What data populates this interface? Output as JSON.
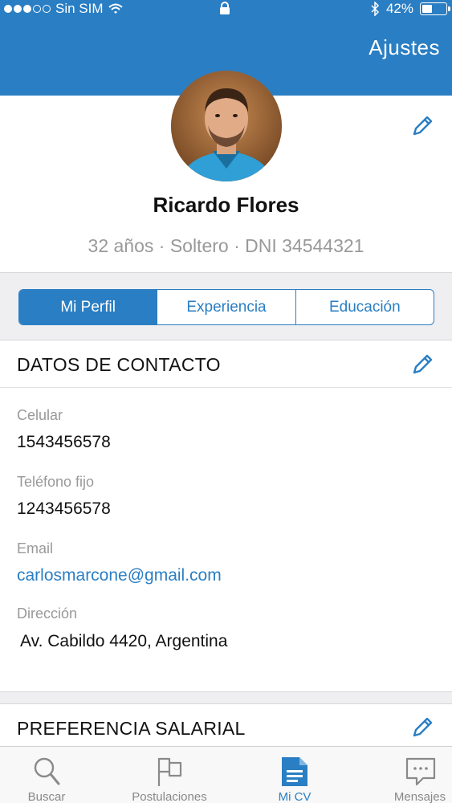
{
  "status_bar": {
    "carrier": "Sin SIM",
    "battery": "42%",
    "battery_level": 0.42
  },
  "header": {
    "settings_label": "Ajustes"
  },
  "profile": {
    "name": "Ricardo Flores",
    "details": "32 años · Soltero · DNI 34544321"
  },
  "tabs": [
    {
      "label": "Mi Perfil",
      "active": true
    },
    {
      "label": "Experiencia",
      "active": false
    },
    {
      "label": "Educación",
      "active": false
    }
  ],
  "contact": {
    "title": "DATOS DE CONTACTO",
    "fields": [
      {
        "label": "Celular",
        "value": "1543456578"
      },
      {
        "label": "Teléfono fijo",
        "value": "1243456578"
      },
      {
        "label": "Email",
        "value": "carlosmarcone@gmail.com"
      },
      {
        "label": "Dirección",
        "value": "Av. Cabildo 4420, Argentina"
      }
    ]
  },
  "salary": {
    "title": "PREFERENCIA SALARIAL"
  },
  "bottom_nav": [
    {
      "label": "Buscar",
      "icon": "search-icon"
    },
    {
      "label": "Postulaciones",
      "icon": "flag-icon"
    },
    {
      "label": "Mi CV",
      "icon": "document-icon",
      "active": true
    },
    {
      "label": "Mensajes",
      "icon": "chat-icon"
    }
  ],
  "colors": {
    "primary": "#2a7ec3",
    "muted_text": "#999999",
    "band_bg": "#efeff1"
  }
}
